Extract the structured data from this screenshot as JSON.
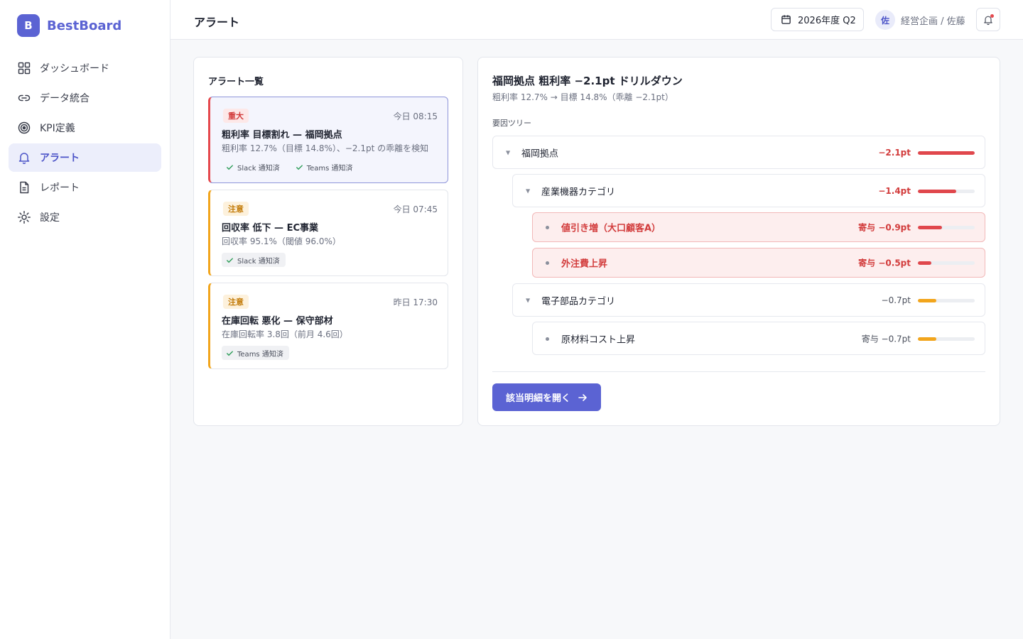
{
  "brand": {
    "mark": "B",
    "name": "BestBoard"
  },
  "nav": [
    {
      "label": "ダッシュボード",
      "icon": "grid-icon"
    },
    {
      "label": "データ統合",
      "icon": "link-icon"
    },
    {
      "label": "KPI定義",
      "icon": "target-icon"
    },
    {
      "label": "アラート",
      "icon": "bell-icon",
      "active": true
    },
    {
      "label": "レポート",
      "icon": "document-icon"
    },
    {
      "label": "設定",
      "icon": "gear-icon"
    }
  ],
  "header": {
    "title": "アラート",
    "period": "2026年度 Q2",
    "user_initial": "佐",
    "user_name": "経営企画 / 佐藤"
  },
  "alerts": {
    "heading": "アラート一覧",
    "items": [
      {
        "severity": "重大",
        "time": "今日 08:15",
        "title": "粗利率 目標割れ — 福岡拠点",
        "desc": "粗利率 12.7%（目標 14.8%）、−2.1pt の乖離を検知",
        "notify": [
          "Slack 通知済",
          "Teams 通知済"
        ]
      },
      {
        "severity": "注意",
        "time": "今日 07:45",
        "title": "回収率 低下 — EC事業",
        "desc": "回収率 95.1%（閾値 96.0%）",
        "notify": [
          "Slack 通知済"
        ]
      },
      {
        "severity": "注意",
        "time": "昨日 17:30",
        "title": "在庫回転 悪化 — 保守部材",
        "desc": "在庫回転率 3.8回（前月 4.6回）",
        "notify": [
          "Teams 通知済"
        ]
      }
    ]
  },
  "detail": {
    "title": "福岡拠点 粗利率 −2.1pt ドリルダウン",
    "subtitle": "粗利率 12.7% → 目標 14.8%（乖離 −2.1pt）",
    "tree_label": "要因ツリー",
    "tree": [
      {
        "name": "福岡拠点",
        "value": "−2.1pt",
        "level": 1.0,
        "color": "#e0474c"
      },
      {
        "name": "産業機器カテゴリ",
        "value": "−1.4pt",
        "level": 0.67,
        "color": "#e0474c"
      },
      {
        "name": "値引き増（大口顧客A）",
        "value": "寄与 −0.9pt",
        "level": 0.43,
        "color": "#e0474c"
      },
      {
        "name": "外注費上昇",
        "value": "寄与 −0.5pt",
        "level": 0.24,
        "color": "#e0474c"
      },
      {
        "name": "電子部品カテゴリ",
        "value": "−0.7pt",
        "level": 0.33,
        "color": "#f2a51c"
      },
      {
        "name": "原材料コスト上昇",
        "value": "寄与 −0.7pt",
        "level": 0.33,
        "color": "#f2a51c"
      }
    ],
    "open_button": "該当明細を開く"
  }
}
